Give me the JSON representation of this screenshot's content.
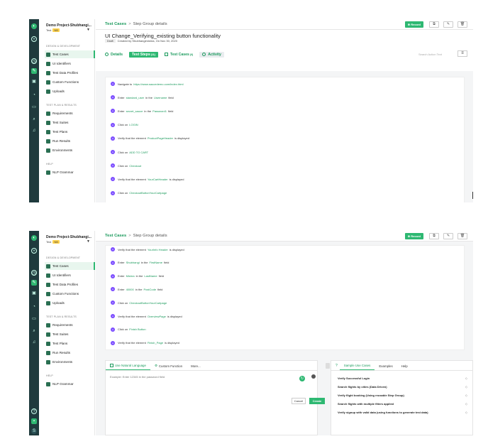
{
  "app": {
    "project_name": "Demo Project-Shubhangi...",
    "project_env": "Test",
    "project_badge": "NB",
    "sections": {
      "design": "DESIGN & DEVELOPMENT",
      "plan": "TEST PLAN & RESULTS",
      "help": "HELP"
    },
    "nav": {
      "test_cases": "Test Cases",
      "ui_identifiers": "UI Identifiers",
      "test_data_profiles": "Test Data Profiles",
      "custom_functions": "Custom Functions",
      "uploads": "Uploads",
      "requirements": "Requirements",
      "test_suites": "Test Suites",
      "test_plans": "Test Plans",
      "run_results": "Run Results",
      "environments": "Environments",
      "nlp_grammar": "NLP Grammar"
    }
  },
  "header": {
    "breadcrumb_root": "Test Cases",
    "breadcrumb_sep": ">",
    "breadcrumb_current": "Step Group details",
    "record_label": "⊕ Record"
  },
  "testcase": {
    "title": "UI Change_Verifying_existing button functionality",
    "status": "Draft",
    "created": "Created by Shubhangimishra, On Nov 30, 2020"
  },
  "tabs": {
    "details": "Details",
    "test_steps": "Test Steps",
    "test_steps_count": "(11)",
    "test_cases": "Test Cases",
    "test_cases_count": "(0)",
    "activity": "Activity",
    "search_placeholder": "Search Action Text"
  },
  "steps_top": [
    {
      "pre": "Navigate to",
      "hl": "https://www.saucedemo.com/index.html",
      "post": ""
    },
    {
      "pre": "Enter",
      "hl": "standard_user",
      "mid": "in the",
      "hl2": "Username",
      "post": "field"
    },
    {
      "pre": "Enter",
      "hl": "secret_sauce",
      "mid": "in the",
      "hl2": "Password1",
      "post": "field"
    },
    {
      "pre": "Click on",
      "hl": "LOGIN",
      "post": ""
    },
    {
      "pre": "Verify that the element",
      "hl": "ProductPageHeader",
      "post": "is displayed"
    },
    {
      "pre": "Click on",
      "hl": "ADD TO CART",
      "post": ""
    },
    {
      "pre": "Click on",
      "hl": "Checkout",
      "post": ""
    },
    {
      "pre": "Verify that the element",
      "hl": "YourCartHeader",
      "post": "is displayed"
    },
    {
      "pre": "Click on",
      "hl": "CheckoutButtonYourCartpage",
      "post": ""
    }
  ],
  "steps_bottom": [
    {
      "pre": "Verify that the element",
      "hl": "YourInfo Header",
      "post": "is displayed"
    },
    {
      "pre": "Enter",
      "hl": "Shubhangi",
      "mid": "in the",
      "hl2": "FirstName",
      "post": "field"
    },
    {
      "pre": "Enter",
      "hl": "Mishra",
      "mid": "in the",
      "hl2": "LastName",
      "post": "field"
    },
    {
      "pre": "Enter",
      "hl": "40000",
      "mid": "in the",
      "hl2": "PostCode",
      "post": "field"
    },
    {
      "pre": "Click on",
      "hl": "CheckoutButtonYourCartpage",
      "post": ""
    },
    {
      "pre": "Verify that the element",
      "hl": "OverviewPage",
      "post": "is displayed"
    },
    {
      "pre": "Click on",
      "hl": "Finish Button",
      "post": ""
    },
    {
      "pre": "Verify that the element",
      "hl": "Finish_Page",
      "post": "is displayed"
    }
  ],
  "editor": {
    "tab_nl": "Use Natural Language",
    "tab_cf": "Custom Function",
    "tab_more": "More...",
    "placeholder": "Example: Enter 12345 in the password field",
    "cancel": "Cancel",
    "create": "Create"
  },
  "samples": {
    "tab_use_cases": "Sample Use Cases",
    "tab_examples": "Examples",
    "tab_help": "Help",
    "items": [
      "Verify Successful Login",
      "Search flights by cities (Data Driven)",
      "Verify flight booking (Using reusable Step Group)",
      "Search flights with multiple filters applied",
      "Verify signup with valid data (using functions to generate test data)"
    ]
  },
  "colors": {
    "accent": "#2eb872",
    "rail": "#1f3a3d",
    "step_badge": "#7c4dff"
  }
}
